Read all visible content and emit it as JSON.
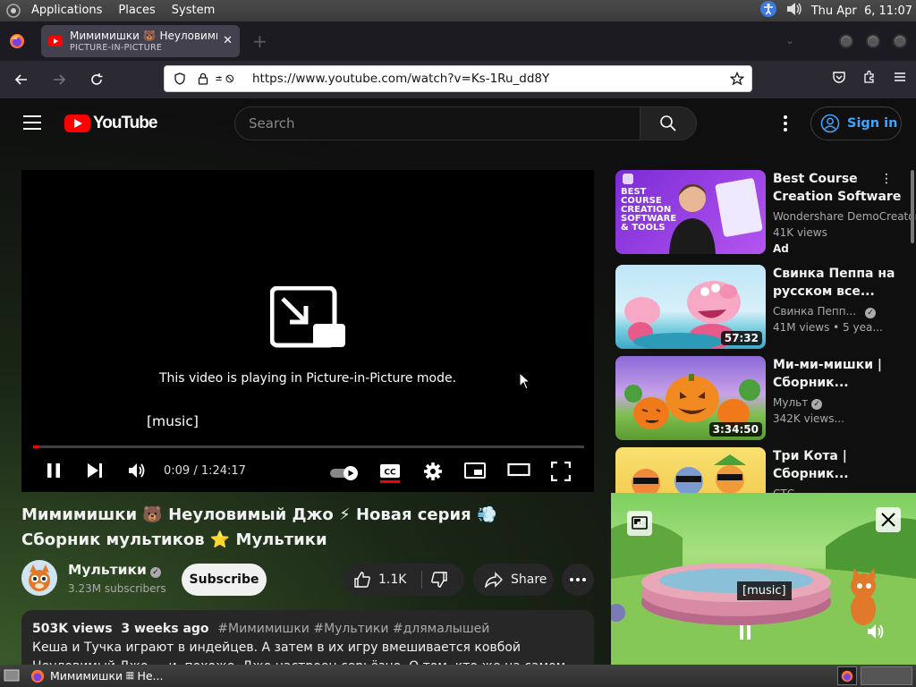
{
  "panel": {
    "menus": [
      "Applications",
      "Places",
      "System"
    ],
    "clock": "Thu Apr  6, 11:07"
  },
  "browser": {
    "tab": {
      "title": "Мимимишки 🐻 Неуловимый Джо ⚡ Новая серия",
      "subtitle": "PICTURE-IN-PICTURE",
      "close": "✕"
    },
    "new_tab": "+",
    "url": "https://www.youtube.com/watch?v=Ks-1Ru_dd8Y"
  },
  "youtube": {
    "logo_text": "YouTube",
    "search_placeholder": "Search",
    "sign_in": "Sign in",
    "player": {
      "pip_message": "This video is playing in Picture-in-Picture mode.",
      "caption": "[music]",
      "time": "0:09 / 1:24:17",
      "progress": 0.002
    },
    "video": {
      "title": "Мимимишки 🐻 Неуловимый Джо ⚡ Новая серия 💨 Сборник мультиков ⭐ Мультики",
      "channel": "Мультики",
      "subscribers": "3.23M subscribers",
      "subscribe": "Subscribe",
      "likes": "1.1K",
      "share": "Share",
      "views": "503K views",
      "age": "3 weeks ago",
      "tags": "#Мимимишки #Мультики #длямалышей",
      "description": "Кеша и Тучка играют в индейцев. А затем в их игру вмешивается ковбой Неуловимый Джо — и, похоже, Джо настроен серьёзно. О том, кто же на самом деле этот ковбой, смотрите в"
    },
    "recommendations": [
      {
        "title": "Best Course Creation Software and Tools f...",
        "channel": "Wondershare DemoCreator",
        "views": "41K views",
        "badge": "Ad",
        "thumb_text": "BEST COURSE CREATION SOFTWARE & TOOLS"
      },
      {
        "title": "Свинка Пеппа на русском все...",
        "channel": "Свинка Пепп...",
        "views": "41M views",
        "age": "• 5 yea...",
        "duration": "57:32"
      },
      {
        "title": "Ми-ми-мишки | Сборник...",
        "channel": "Мульт",
        "views": "342K views...",
        "duration": "3:34:50"
      },
      {
        "title": "Три Кота | Сборник...",
        "channel": "СТС"
      }
    ],
    "pip_window": {
      "caption": "[music]"
    }
  },
  "taskbar": {
    "item": "Мимимишки 𝄜 Не..."
  },
  "colors": {
    "youtube_red": "#ff0000",
    "link_blue": "#3ea6ff",
    "background": "#0f0f0f"
  }
}
